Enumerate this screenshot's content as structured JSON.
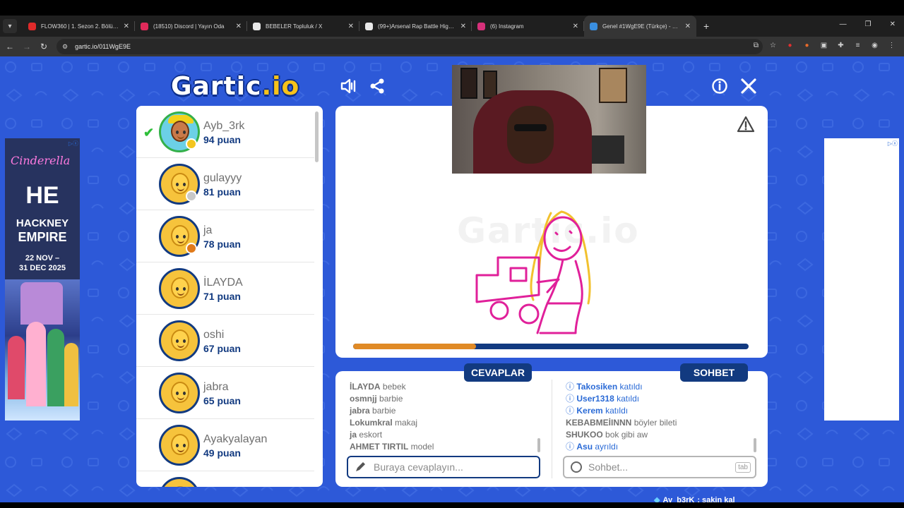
{
  "browser": {
    "tabs": [
      {
        "title": "FLOW360 | 1. Sezon 2. Bölüm -",
        "color": "#e02a2a"
      },
      {
        "title": "(18510) Discord | Yayın Oda",
        "color": "#e02a5a"
      },
      {
        "title": "BEBELER Topluluk / X",
        "color": "#e8e8e8"
      },
      {
        "title": "(99+)Arsenal Rap Battle Highlig",
        "color": "#e8e8e8"
      },
      {
        "title": "(6) Instagram",
        "color": "#d6307a"
      },
      {
        "title": "Genel #1WgE9E (Türkçe) - Gartic",
        "color": "#3a8fe0"
      }
    ],
    "url": "gartic.io/011WgE9E"
  },
  "game": {
    "logo_main": "Gartic",
    "logo_suffix": ".io",
    "players": [
      {
        "name": "Ayb_3rk",
        "score": "94 puan",
        "dot": "#f3c51f",
        "special": true,
        "check": true
      },
      {
        "name": "gulayyy",
        "score": "81 puan",
        "dot": "#c8c8c8"
      },
      {
        "name": "ja",
        "score": "78 puan",
        "dot": "#e07a1a"
      },
      {
        "name": "İLAYDA",
        "score": "71 puan"
      },
      {
        "name": "oshi",
        "score": "67 puan"
      },
      {
        "name": "jabra",
        "score": "65 puan"
      },
      {
        "name": "Ayakyalayan",
        "score": "49 puan"
      }
    ],
    "progress_fraction": 0.31,
    "answers_label": "CEVAPLAR",
    "chat_label": "SOHBET",
    "answers": [
      {
        "user": "İLAYDA",
        "text": "bebek"
      },
      {
        "user": "osmnjj",
        "text": "barbie"
      },
      {
        "user": "jabra",
        "text": "barbie"
      },
      {
        "user": "Lokumkral",
        "text": "makaj"
      },
      {
        "user": "ja",
        "text": "eskort"
      },
      {
        "user": "AHMET TIRTIL",
        "text": "model"
      }
    ],
    "chat": [
      {
        "user": "Takosiken",
        "text": "katıldı",
        "system": true
      },
      {
        "user": "User1318",
        "text": "katıldı",
        "system": true
      },
      {
        "user": "Kerem",
        "text": "katıldı",
        "system": true
      },
      {
        "user": "KEBABMEİINNN",
        "text": "böyler bileti",
        "system": false
      },
      {
        "user": "SHUKOO",
        "text": "bok gibi aw",
        "system": false
      },
      {
        "user": "Asu",
        "text": "ayrıldı",
        "system": true
      }
    ],
    "answer_placeholder": "Buraya cevaplayın...",
    "chat_placeholder": "Sohbet...",
    "tab_key": "tab",
    "footer_user": "Ay_b3rK",
    "footer_text": ": sakin kal"
  },
  "ad_left": {
    "title": "Cinderella",
    "brand1": "HE",
    "brand2": "HACKNEY",
    "brand3": "EMPIRE",
    "dates1": "22 NOV –",
    "dates2": "31 DEC 2025"
  }
}
